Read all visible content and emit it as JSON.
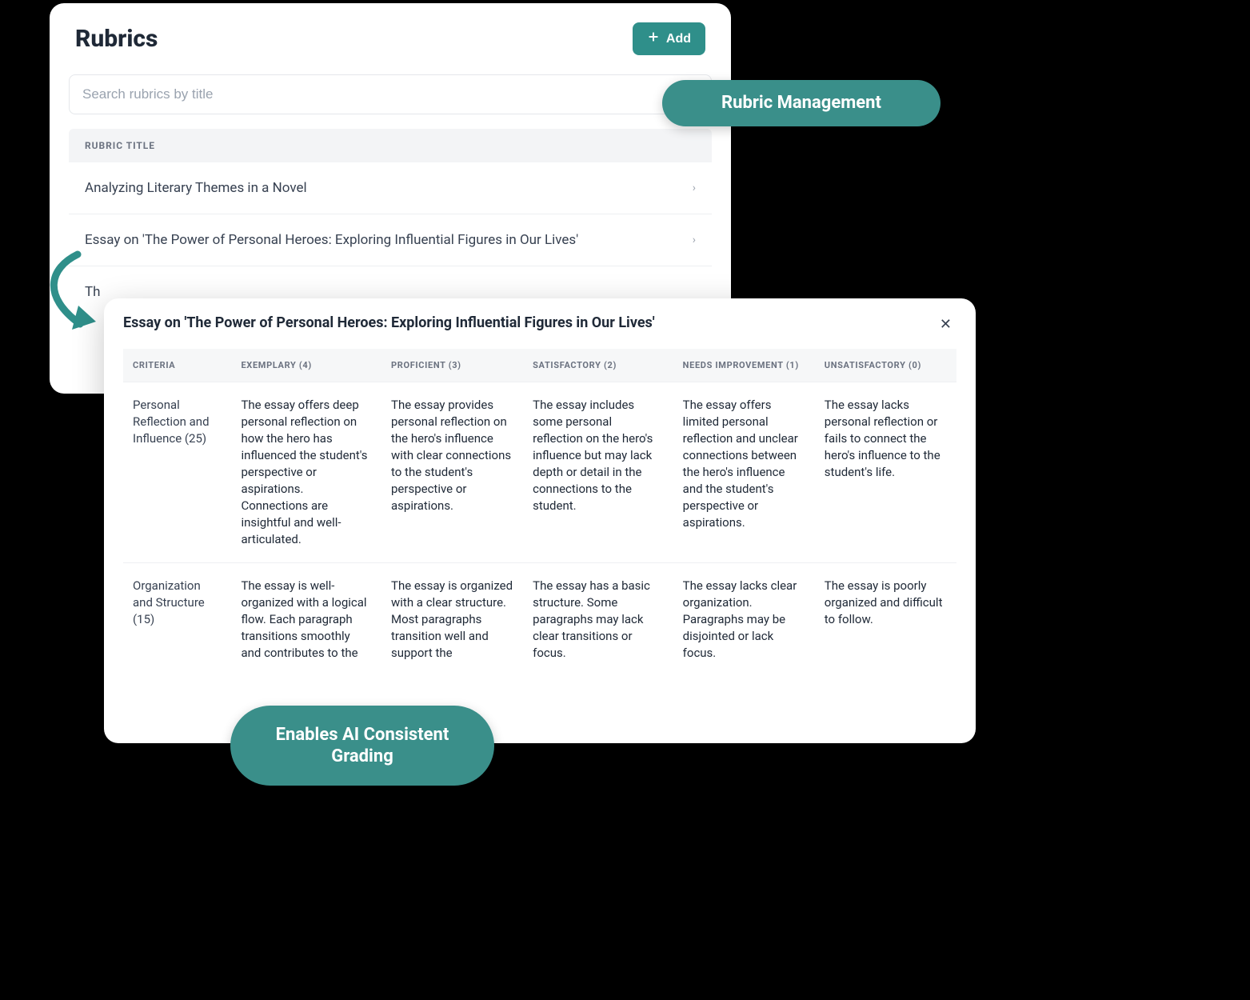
{
  "back": {
    "title": "Rubrics",
    "add_label": "Add",
    "search_placeholder": "Search rubrics by title",
    "list_header": "RUBRIC TITLE",
    "rows": [
      "Analyzing Literary Themes in a Novel",
      "Essay on 'The Power of Personal Heroes: Exploring Influential Figures in Our Lives'"
    ],
    "cutoff_row_prefix": "Th"
  },
  "front": {
    "title": "Essay on 'The Power of Personal Heroes: Exploring Influential Figures in Our Lives'",
    "columns": [
      "CRITERIA",
      "EXEMPLARY (4)",
      "PROFICIENT (3)",
      "SATISFACTORY (2)",
      "NEEDS IMPROVEMENT (1)",
      "UNSATISFACTORY (0)"
    ],
    "rows": [
      {
        "criteria": "Personal Reflection and Influence (25)",
        "cells": [
          "The essay offers deep personal reflection on how the hero has influenced the student's perspective or aspirations. Connections are insightful and well-articulated.",
          "The essay provides personal reflection on the hero's influence with clear connections to the student's perspective or aspirations.",
          "The essay includes some personal reflection on the hero's influence but may lack depth or detail in the connections to the student.",
          "The essay offers limited personal reflection and unclear connections between the hero's influence and the student's perspective or aspirations.",
          "The essay lacks personal reflection or fails to connect the hero's influence to the student's life."
        ]
      },
      {
        "criteria": "Organization and Structure (15)",
        "cells": [
          "The essay is well-organized with a logical flow. Each paragraph transitions smoothly and contributes to the",
          "The essay is organized with a clear structure. Most paragraphs transition well and support the",
          "The essay has a basic structure. Some paragraphs may lack clear transitions or focus.",
          "The essay lacks clear organization. Paragraphs may be disjointed or lack focus.",
          "The essay is poorly organized and difficult to follow."
        ]
      }
    ]
  },
  "badges": {
    "top": "Rubric Management",
    "bottom": "Enables AI Consistent Grading"
  }
}
